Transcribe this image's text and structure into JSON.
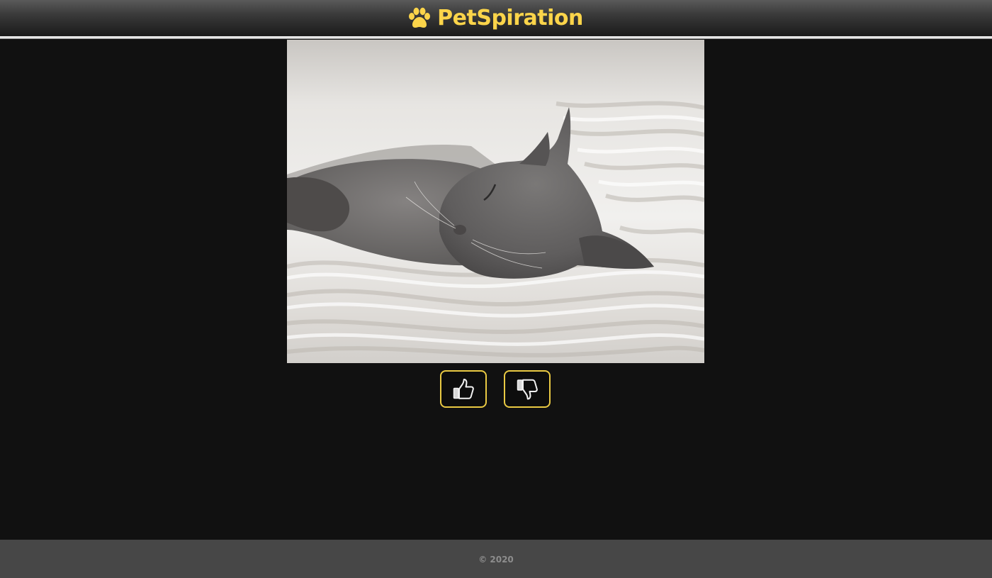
{
  "header": {
    "brand_name": "PetSpiration",
    "brand_icon": "paw-icon",
    "brand_color": "#fbd44a"
  },
  "photo": {
    "alt": "cat"
  },
  "actions": {
    "like_icon": "thumbs-up-icon",
    "dislike_icon": "thumbs-down-icon",
    "button_border_color": "#e9c943"
  },
  "footer": {
    "copyright": "© 2020"
  }
}
